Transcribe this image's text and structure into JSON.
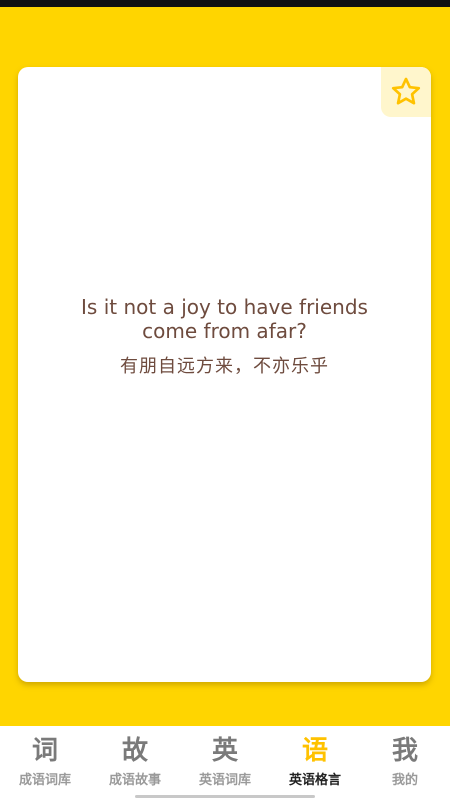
{
  "quote": {
    "english": "Is it not a joy to have friends come from afar?",
    "chinese": "有朋自远方来，不亦乐乎"
  },
  "favorite": {
    "icon": "star-outline-icon",
    "color": "#FFC200"
  },
  "tabs": [
    {
      "icon_char": "词",
      "label": "成语词库",
      "active": false
    },
    {
      "icon_char": "故",
      "label": "成语故事",
      "active": false
    },
    {
      "icon_char": "英",
      "label": "英语词库",
      "active": false
    },
    {
      "icon_char": "语",
      "label": "英语格言",
      "active": true
    },
    {
      "icon_char": "我",
      "label": "我的",
      "active": false
    }
  ],
  "colors": {
    "background": "#FFD500",
    "card": "#FFFFFF",
    "quote_text": "#6E4B3E",
    "active_tab_icon": "#FFC200"
  }
}
